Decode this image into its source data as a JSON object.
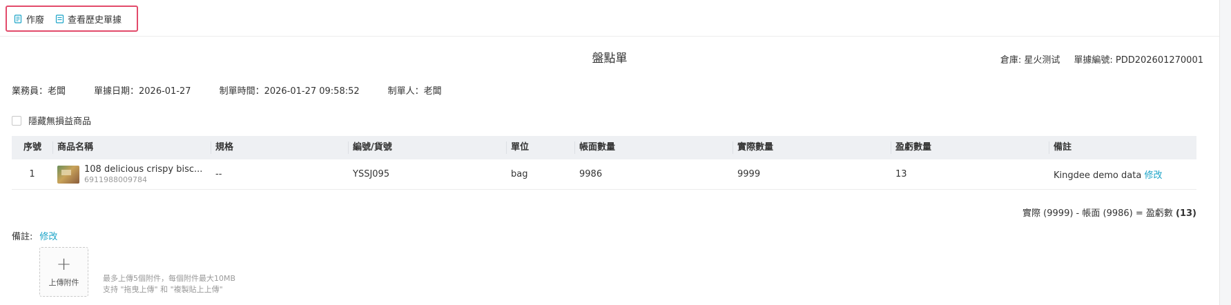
{
  "toolbar": {
    "void_label": "作廢",
    "history_label": "查看歷史單據"
  },
  "document": {
    "title": "盤點單",
    "warehouse": "倉庫: 星火测试",
    "doc_no": "單據編號: PDD202601270001"
  },
  "info": {
    "salesperson": "業務員：老闆",
    "doc_date": "單據日期：2026-01-27",
    "created_time": "制單時間：2026-01-27 09:58:52",
    "creator": "制單人：老闆"
  },
  "hide_no_diff_label": "隱藏無損益商品",
  "table": {
    "headers": [
      "序號",
      "商品名稱",
      "規格",
      "編號/貨號",
      "單位",
      "帳面數量",
      "實際數量",
      "盈虧數量",
      "備註"
    ],
    "rows": [
      {
        "index": "1",
        "name": "108 delicious crispy bisc...",
        "barcode": "6911988009784",
        "spec": "--",
        "code": "YSSJ095",
        "unit": "bag",
        "book_qty": "9986",
        "actual_qty": "9999",
        "diff_qty": "13",
        "remark": "Kingdee demo data",
        "edit_label": "修改"
      }
    ]
  },
  "formula": {
    "text": "實際 (9999) - 帳面 (9986) = 盈虧數 ",
    "result": "(13)"
  },
  "remark": {
    "label": "備註:",
    "edit_label": "修改"
  },
  "upload": {
    "label": "上傳附件",
    "hint_line1": "最多上傳5個附件，每個附件最大10MB",
    "hint_line2": "支持 \"拖曳上傳\" 和 \"複製貼上上傳\""
  },
  "colors": {
    "accent": "#1aa3c7",
    "highlight_border": "#e24a6a",
    "table_header_bg": "#eef0f3"
  },
  "icons": [
    "document-icon",
    "document-list-icon",
    "plus-icon"
  ]
}
